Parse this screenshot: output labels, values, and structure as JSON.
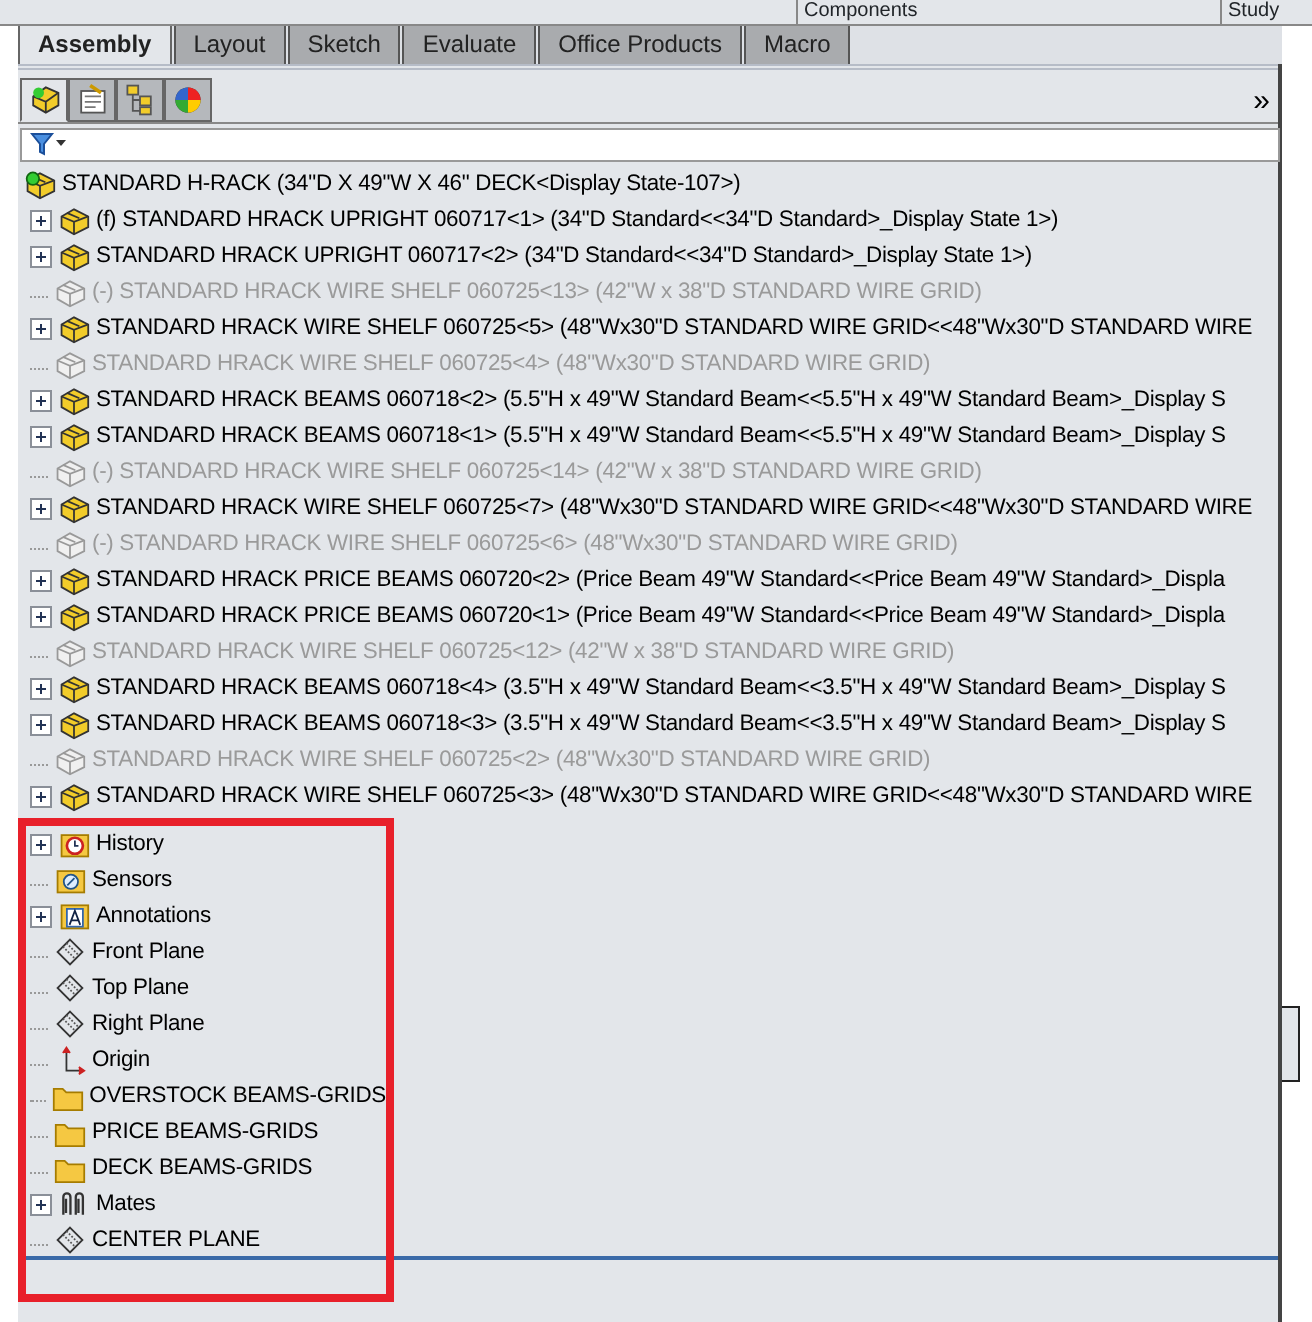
{
  "top_strip": [
    "Components",
    "Study"
  ],
  "tabs": [
    {
      "label": "Assembly",
      "selected": true
    },
    {
      "label": "Layout",
      "selected": false
    },
    {
      "label": "Sketch",
      "selected": false
    },
    {
      "label": "Evaluate",
      "selected": false
    },
    {
      "label": "Office Products",
      "selected": false
    },
    {
      "label": "Macro",
      "selected": false
    }
  ],
  "panel_tabs": [
    {
      "kind": "tree",
      "selected": true
    },
    {
      "kind": "properties",
      "selected": false
    },
    {
      "kind": "config",
      "selected": false
    },
    {
      "kind": "appearance",
      "selected": false
    }
  ],
  "overflow_button": "»",
  "tree": {
    "root": "STANDARD H-RACK  (34\"D X 49\"W X 46\" DECK<Display State-107>)",
    "items": [
      {
        "kind": "component",
        "expandable": true,
        "suppressed": false,
        "label": "(f) STANDARD HRACK UPRIGHT 060717<1> (34\"D Standard<<34\"D Standard>_Display State 1>)"
      },
      {
        "kind": "component",
        "expandable": true,
        "suppressed": false,
        "label": "STANDARD HRACK UPRIGHT 060717<2> (34\"D Standard<<34\"D Standard>_Display State 1>)"
      },
      {
        "kind": "component",
        "expandable": false,
        "suppressed": true,
        "label": "(-) STANDARD HRACK WIRE SHELF 060725<13> (42\"W x 38\"D STANDARD WIRE GRID)"
      },
      {
        "kind": "component",
        "expandable": true,
        "suppressed": false,
        "label": "STANDARD HRACK WIRE SHELF 060725<5> (48\"Wx30\"D STANDARD WIRE GRID<<48\"Wx30\"D STANDARD WIRE"
      },
      {
        "kind": "component",
        "expandable": false,
        "suppressed": true,
        "label": "STANDARD HRACK WIRE SHELF 060725<4> (48\"Wx30\"D STANDARD WIRE GRID)"
      },
      {
        "kind": "component",
        "expandable": true,
        "suppressed": false,
        "label": "STANDARD HRACK BEAMS 060718<2> (5.5\"H x 49\"W Standard Beam<<5.5\"H x 49\"W Standard Beam>_Display S"
      },
      {
        "kind": "component",
        "expandable": true,
        "suppressed": false,
        "label": "STANDARD HRACK BEAMS 060718<1> (5.5\"H x 49\"W Standard Beam<<5.5\"H x 49\"W Standard Beam>_Display S"
      },
      {
        "kind": "component",
        "expandable": false,
        "suppressed": true,
        "label": "(-) STANDARD HRACK WIRE SHELF 060725<14> (42\"W x 38\"D STANDARD WIRE GRID)"
      },
      {
        "kind": "component",
        "expandable": true,
        "suppressed": false,
        "label": "STANDARD HRACK WIRE SHELF 060725<7> (48\"Wx30\"D STANDARD WIRE GRID<<48\"Wx30\"D STANDARD WIRE"
      },
      {
        "kind": "component",
        "expandable": false,
        "suppressed": true,
        "label": "(-) STANDARD HRACK WIRE SHELF 060725<6> (48\"Wx30\"D STANDARD WIRE GRID)"
      },
      {
        "kind": "component",
        "expandable": true,
        "suppressed": false,
        "label": "STANDARD HRACK PRICE BEAMS 060720<2> (Price Beam 49\"W Standard<<Price Beam 49\"W Standard>_Displa"
      },
      {
        "kind": "component",
        "expandable": true,
        "suppressed": false,
        "label": "STANDARD HRACK PRICE BEAMS 060720<1> (Price Beam 49\"W Standard<<Price Beam 49\"W Standard>_Displa"
      },
      {
        "kind": "component",
        "expandable": false,
        "suppressed": true,
        "label": "STANDARD HRACK WIRE SHELF 060725<12> (42\"W x 38\"D STANDARD WIRE GRID)"
      },
      {
        "kind": "component",
        "expandable": true,
        "suppressed": false,
        "label": "STANDARD HRACK BEAMS 060718<4> (3.5\"H x 49\"W Standard Beam<<3.5\"H x 49\"W Standard Beam>_Display S"
      },
      {
        "kind": "component",
        "expandable": true,
        "suppressed": false,
        "label": "STANDARD HRACK BEAMS 060718<3> (3.5\"H x 49\"W Standard Beam<<3.5\"H x 49\"W Standard Beam>_Display S"
      },
      {
        "kind": "component",
        "expandable": false,
        "suppressed": true,
        "label": "STANDARD HRACK WIRE SHELF 060725<2> (48\"Wx30\"D STANDARD WIRE GRID)"
      },
      {
        "kind": "component",
        "expandable": true,
        "suppressed": false,
        "label": "STANDARD HRACK WIRE SHELF 060725<3> (48\"Wx30\"D STANDARD WIRE GRID<<48\"Wx30\"D STANDARD WIRE"
      }
    ],
    "framed_items": [
      {
        "kind": "history",
        "expandable": true,
        "label": "History"
      },
      {
        "kind": "sensors",
        "expandable": false,
        "label": "Sensors"
      },
      {
        "kind": "annotations",
        "expandable": true,
        "label": "Annotations"
      },
      {
        "kind": "plane",
        "expandable": false,
        "label": "Front Plane"
      },
      {
        "kind": "plane",
        "expandable": false,
        "label": "Top Plane"
      },
      {
        "kind": "plane",
        "expandable": false,
        "label": "Right Plane"
      },
      {
        "kind": "origin",
        "expandable": false,
        "label": "Origin"
      },
      {
        "kind": "folder",
        "expandable": false,
        "label": "OVERSTOCK BEAMS-GRIDS"
      },
      {
        "kind": "folder",
        "expandable": false,
        "label": "PRICE BEAMS-GRIDS"
      },
      {
        "kind": "folder",
        "expandable": false,
        "label": "DECK BEAMS-GRIDS"
      },
      {
        "kind": "mates",
        "expandable": true,
        "label": "Mates"
      },
      {
        "kind": "plane",
        "expandable": false,
        "label": "CENTER PLANE"
      }
    ]
  }
}
